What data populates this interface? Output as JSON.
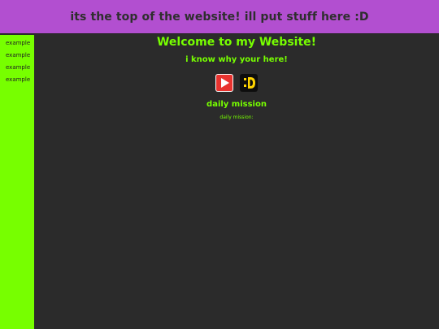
{
  "header": {
    "title": "its the top of the website! ill put stuff here :D"
  },
  "sidebar": {
    "items": [
      {
        "label": "example"
      },
      {
        "label": "example"
      },
      {
        "label": "example"
      },
      {
        "label": "example"
      }
    ]
  },
  "main": {
    "welcome": "Welcome to my Website!",
    "subtitle": "i know why your here!",
    "icons": [
      "youtube-logo-icon",
      "smiley-face-icon"
    ],
    "mission_heading": "daily mission",
    "mission_text": "daily mission:"
  },
  "colors": {
    "topbar": "#b24fd0",
    "sidebar": "#77ff00",
    "background": "#2b2b2b",
    "accent_text": "#77ff00"
  }
}
